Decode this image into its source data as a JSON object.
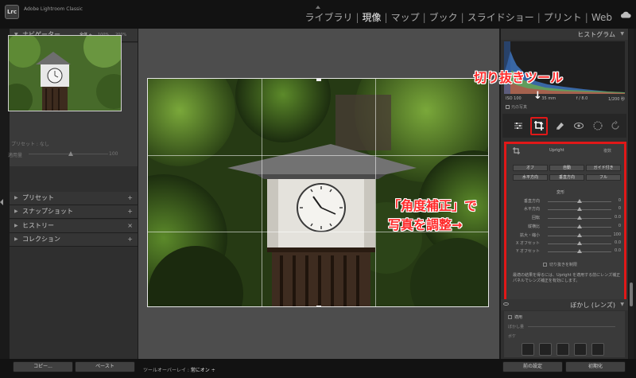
{
  "app": {
    "logo": "Lrc",
    "name": "Adobe Lightroom Classic"
  },
  "modules": [
    "ライブラリ",
    "現像",
    "マップ",
    "ブック",
    "スライドショー",
    "プリント",
    "Web"
  ],
  "active_module": "現像",
  "left_panel": {
    "navigator": {
      "title": "ナビゲーター",
      "fit": "全体 ÷",
      "zoom_100": "100%",
      "zoom_200": "200%"
    },
    "preset": "プリセット : なし",
    "amount_label": "適用量",
    "amount_value": "100",
    "sections": [
      {
        "label": "プリセット",
        "action": "+"
      },
      {
        "label": "スナップショット",
        "action": "+"
      },
      {
        "label": "ヒストリー",
        "action": "×"
      },
      {
        "label": "コレクション",
        "action": "+"
      }
    ]
  },
  "right_panel": {
    "histogram_title": "ヒストグラム",
    "exif": {
      "iso": "ISO 100",
      "focal": "35 mm",
      "aperture": "f / 8.0",
      "shutter": "1/200 秒"
    },
    "original_photo": "元の写真",
    "upright": {
      "title": "Upright",
      "off_label": "複数",
      "buttons": [
        "オフ",
        "自動",
        "ガイド付き",
        "水平方向",
        "垂直方向",
        "フル"
      ]
    },
    "transform_label": "変形",
    "sliders": [
      {
        "label": "垂直方向",
        "value": "0",
        "pos": 0.5
      },
      {
        "label": "水平方向",
        "value": "0",
        "pos": 0.5
      },
      {
        "label": "回転",
        "value": "0.0",
        "pos": 0.5
      },
      {
        "label": "縦横比",
        "value": "0",
        "pos": 0.5
      },
      {
        "label": "拡大・縮小",
        "value": "100",
        "pos": 0.5
      },
      {
        "label": "X オフセット",
        "value": "0.0",
        "pos": 0.5
      },
      {
        "label": "Y オフセット",
        "value": "0.0",
        "pos": 0.5
      }
    ],
    "constrain_crop": "切り抜きを制限",
    "note": "最適の結果を得るには、Upright を適用する前にレンズ補正パネルでレンズ補正を有効にします。",
    "blur_title": "ぼかし (レンズ)",
    "apply_label": "適用",
    "blur_amount_label": "ぼかし量",
    "bokeh_label": "ボケ"
  },
  "annotations": {
    "crop_tool": "切り抜きツール",
    "arrow": "↓",
    "angle_line1": "「角度補正」で",
    "angle_line2": "写真を調整→"
  },
  "bottom": {
    "copy": "コピー...",
    "paste": "ペースト",
    "overlay_label": "ツールオーバーレイ : ",
    "overlay_value": "常にオン ÷",
    "previous": "前の設定",
    "reset": "初期化"
  },
  "colors": {
    "annotation_red": "#e01818",
    "panel": "#2f2f2f",
    "background": "#4d4d4d"
  }
}
